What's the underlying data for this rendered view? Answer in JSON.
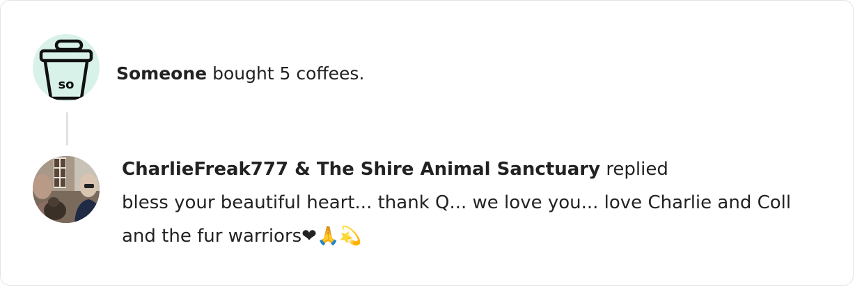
{
  "support_event": {
    "supporter_name": "Someone",
    "action_text": "bought 5 coffees.",
    "avatar_icon": "coffee-cup-icon",
    "avatar_cup_text": "so",
    "avatar_bg_color": "#d8f2ea"
  },
  "reply": {
    "author": "CharlieFreak777 & The Shire Animal Sanctuary",
    "verb": "replied",
    "message": "bless your beautiful heart... thank Q... we love you... love Charlie and Coll and the fur warriors❤🙏💫",
    "avatar_icon": "user-photo-avatar"
  }
}
